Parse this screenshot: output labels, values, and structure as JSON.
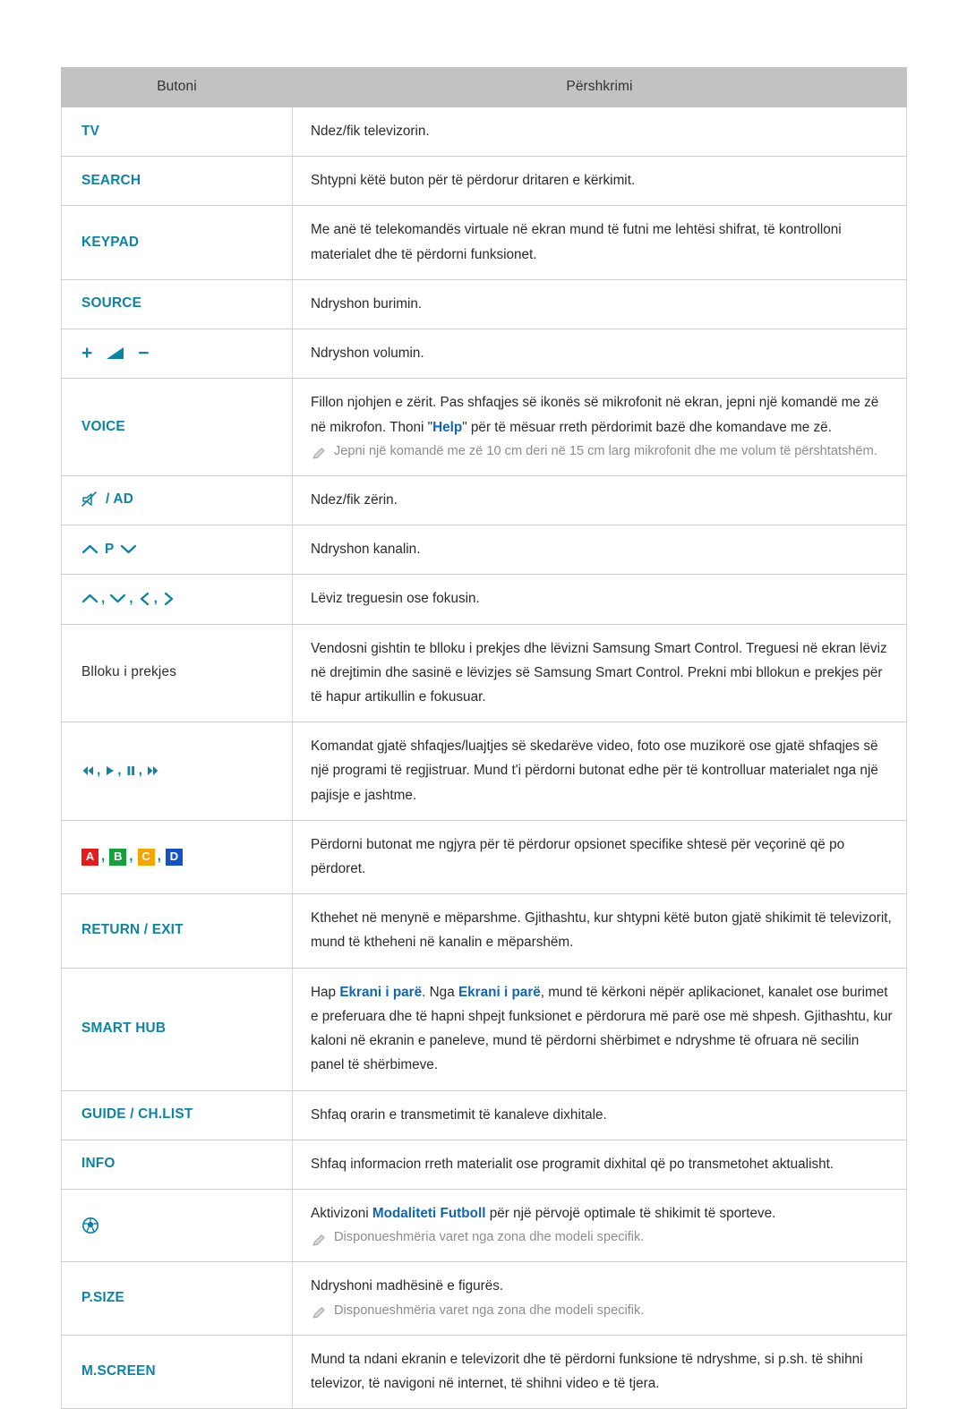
{
  "table": {
    "headers": {
      "button": "Butoni",
      "description": "Përshkrimi"
    },
    "rows": [
      {
        "id": "tv",
        "label": "TV",
        "label_kind": "text",
        "desc": "Ndez/fik televizorin."
      },
      {
        "id": "search",
        "label": "SEARCH",
        "label_kind": "text",
        "desc": "Shtypni këtë buton për të përdorur dritaren e kërkimit."
      },
      {
        "id": "keypad",
        "label": "KEYPAD",
        "label_kind": "text",
        "desc": "Me anë të telekomandës virtuale në ekran mund të futni me lehtësi shifrat, të kontrolloni materialet dhe të përdorni funksionet."
      },
      {
        "id": "source",
        "label": "SOURCE",
        "label_kind": "text",
        "desc": "Ndryshon burimin."
      },
      {
        "id": "volume",
        "label": "+ volume-wedge −",
        "label_kind": "icon-volume",
        "desc": "Ndryshon volumin."
      },
      {
        "id": "voice",
        "label": "VOICE",
        "label_kind": "text",
        "desc_parts": [
          {
            "t": "Fillon njohjen e zërit. Pas shfaqjes së ikonës së mikrofonit në ekran, jepni një komandë me zë në mikrofon. Thoni \"",
            "k": false
          },
          {
            "t": "Help",
            "k": true
          },
          {
            "t": "\" për të mësuar rreth përdorimit bazë dhe komandave me zë.",
            "k": false
          }
        ],
        "note": "Jepni një komandë me zë 10 cm deri në 15 cm larg mikrofonit dhe me volum të përshtatshëm."
      },
      {
        "id": "mute-ad",
        "label": "/ AD",
        "label_kind": "icon-mute",
        "desc": "Ndez/fik zërin."
      },
      {
        "id": "channel",
        "label": "P",
        "label_kind": "icon-channel",
        "desc": "Ndryshon kanalin."
      },
      {
        "id": "direction",
        "label": "",
        "label_kind": "icon-arrows",
        "desc": "Lëviz treguesin ose fokusin."
      },
      {
        "id": "touchpad",
        "label": "Blloku i prekjes",
        "label_kind": "plain",
        "desc": "Vendosni gishtin te blloku i prekjes dhe lëvizni Samsung Smart Control. Treguesi në ekran lëviz në drejtimin dhe sasinë e lëvizjes së Samsung Smart Control. Prekni mbi bllokun e prekjes për të hapur artikullin e fokusuar."
      },
      {
        "id": "playback",
        "label": "",
        "label_kind": "icon-playback",
        "desc": "Komandat gjatë shfaqjes/luajtjes së skedarëve video, foto ose muzikorë ose gjatë shfaqjes së një programi të regjistruar. Mund t'i përdorni butonat edhe për të kontrolluar materialet nga një pajisje e jashtme."
      },
      {
        "id": "color-buttons",
        "label": "A, B, C, D",
        "label_kind": "icon-colors",
        "desc": "Përdorni butonat me ngjyra për të përdorur opsionet specifike shtesë për veçorinë që po përdoret."
      },
      {
        "id": "return-exit",
        "label": "RETURN / EXIT",
        "label_kind": "text",
        "desc": "Kthehet në menynë e mëparshme. Gjithashtu, kur shtypni këtë buton gjatë shikimit të televizorit, mund të ktheheni në kanalin e mëparshëm."
      },
      {
        "id": "smart-hub",
        "label": "SMART HUB",
        "label_kind": "text",
        "desc_parts": [
          {
            "t": "Hap ",
            "k": false
          },
          {
            "t": "Ekrani i parë",
            "k": true
          },
          {
            "t": ". Nga ",
            "k": false
          },
          {
            "t": "Ekrani i parë",
            "k": true
          },
          {
            "t": ", mund të kërkoni nëpër aplikacionet, kanalet ose burimet e preferuara dhe të hapni shpejt funksionet e përdorura më parë ose më shpesh. Gjithashtu, kur kaloni në ekranin e paneleve, mund të përdorni shërbimet e ndryshme të ofruara në secilin panel të shërbimeve.",
            "k": false
          }
        ]
      },
      {
        "id": "guide-chlist",
        "label": "GUIDE / CH.LIST",
        "label_kind": "text",
        "desc": "Shfaq orarin e transmetimit të kanaleve dixhitale."
      },
      {
        "id": "info",
        "label": "INFO",
        "label_kind": "text",
        "desc": "Shfaq informacion rreth materialit ose programit dixhital që po transmetohet aktualisht."
      },
      {
        "id": "football",
        "label": "",
        "label_kind": "icon-football",
        "desc_parts": [
          {
            "t": "Aktivizoni ",
            "k": false
          },
          {
            "t": "Modaliteti Futboll",
            "k": true
          },
          {
            "t": " për një përvojë optimale të shikimit të sporteve.",
            "k": false
          }
        ],
        "note": "Disponueshmëria varet nga zona dhe modeli specifik."
      },
      {
        "id": "p-size",
        "label": "P.SIZE",
        "label_kind": "text",
        "desc": "Ndryshoni madhësinë e figurës.",
        "note": "Disponueshmëria varet nga zona dhe modeli specifik."
      },
      {
        "id": "m-screen",
        "label": "M.SCREEN",
        "label_kind": "text",
        "desc": "Mund ta ndani ekranin e televizorit dhe të përdorni funksione të ndryshme, si p.sh. të shihni televizor, të navigoni në internet, të shihni video e të tjera."
      }
    ]
  },
  "icons": {
    "volume_plus": "+",
    "volume_minus": "−",
    "channel_letter": "P",
    "color_buttons": [
      {
        "letter": "A",
        "color": "#e8191b"
      },
      {
        "letter": "B",
        "color": "#12a13a"
      },
      {
        "letter": "C",
        "color": "#f5a400"
      },
      {
        "letter": "D",
        "color": "#1450c8"
      }
    ],
    "comma": ","
  },
  "colors": {
    "accent_teal": "#0e84a3",
    "keyword_blue": "#1166b3",
    "header_bg": "#c2c2c2",
    "note_gray": "#8d8d8d",
    "body_text": "#2b2b2b",
    "border": "#cfcfcf"
  }
}
